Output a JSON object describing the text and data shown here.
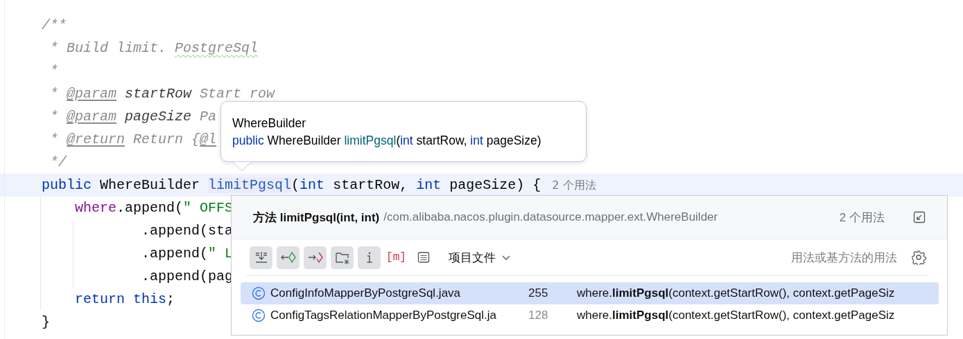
{
  "editor": {
    "lines": [
      {
        "current": false,
        "tokens": [
          {
            "kind": "comment",
            "text": "/**"
          }
        ]
      },
      {
        "current": false,
        "tokens": [
          {
            "kind": "comment",
            "text": " * Build limit. "
          },
          {
            "kind": "typo",
            "text": "PostgreSql"
          }
        ]
      },
      {
        "current": false,
        "tokens": [
          {
            "kind": "comment",
            "text": " *"
          }
        ]
      },
      {
        "current": false,
        "tokens": [
          {
            "kind": "comment",
            "text": " * "
          },
          {
            "kind": "tag",
            "text": "@param"
          },
          {
            "kind": "param",
            "text": " startRow"
          },
          {
            "kind": "comment",
            "text": " Start row"
          }
        ]
      },
      {
        "current": false,
        "tokens": [
          {
            "kind": "comment",
            "text": " * "
          },
          {
            "kind": "tag",
            "text": "@param"
          },
          {
            "kind": "param",
            "text": " pageSize"
          },
          {
            "kind": "comment",
            "text": " Pa"
          }
        ]
      },
      {
        "current": false,
        "tokens": [
          {
            "kind": "comment",
            "text": " * "
          },
          {
            "kind": "tag",
            "text": "@return"
          },
          {
            "kind": "comment",
            "text": " Return {"
          },
          {
            "kind": "tag",
            "text": "@l"
          }
        ]
      },
      {
        "current": false,
        "tokens": [
          {
            "kind": "comment",
            "text": " */"
          }
        ]
      },
      {
        "current": true,
        "tokens": [
          {
            "kind": "keyword",
            "text": "public"
          },
          {
            "kind": "plain",
            "text": " WhereBuilder "
          },
          {
            "kind": "usage",
            "text": "limitPgsql"
          },
          {
            "kind": "plain",
            "text": "("
          },
          {
            "kind": "keyword",
            "text": "int"
          },
          {
            "kind": "plain",
            "text": " startRow, "
          },
          {
            "kind": "keyword",
            "text": "int"
          },
          {
            "kind": "plain",
            "text": " pageSize) {"
          },
          {
            "kind": "hint",
            "text": "2 个用法"
          }
        ]
      },
      {
        "current": false,
        "tokens": [
          {
            "kind": "field",
            "text": "    where"
          },
          {
            "kind": "plain",
            "text": ".append("
          },
          {
            "kind": "string",
            "text": "\" OFFS"
          }
        ]
      },
      {
        "current": false,
        "tokens": [
          {
            "kind": "plain",
            "text": "            .append(sta"
          }
        ]
      },
      {
        "current": false,
        "tokens": [
          {
            "kind": "plain",
            "text": "            .append("
          },
          {
            "kind": "string",
            "text": "\" L"
          }
        ]
      },
      {
        "current": false,
        "tokens": [
          {
            "kind": "plain",
            "text": "            .append(pag"
          }
        ]
      },
      {
        "current": false,
        "tokens": [
          {
            "kind": "keyword",
            "text": "    return this"
          },
          {
            "kind": "plain",
            "text": ";"
          }
        ]
      },
      {
        "current": false,
        "tokens": [
          {
            "kind": "plain",
            "text": "}"
          }
        ]
      }
    ]
  },
  "tooltip": {
    "title": "WhereBuilder",
    "signature": [
      {
        "kind": "keyword",
        "text": "public"
      },
      {
        "kind": "plain",
        "text": " WhereBuilder "
      },
      {
        "kind": "method",
        "text": "limitPgsql"
      },
      {
        "kind": "plain",
        "text": "("
      },
      {
        "kind": "keyword",
        "text": "int"
      },
      {
        "kind": "plain",
        "text": " startRow, "
      },
      {
        "kind": "keyword",
        "text": "int"
      },
      {
        "kind": "plain",
        "text": " pageSize)"
      }
    ]
  },
  "usages_popup": {
    "title": "方法 limitPgsql(int, int)",
    "path": "/com.alibaba.nacos.plugin.datasource.mapper.ext.WhereBuilder",
    "count": "2 个用法",
    "toolbar": [
      {
        "kind": "merge",
        "selected": true
      },
      {
        "kind": "read",
        "selected": true
      },
      {
        "kind": "write",
        "selected": true
      },
      {
        "kind": "folder",
        "selected": true
      },
      {
        "kind": "info",
        "selected": true
      },
      {
        "kind": "module",
        "glyph": "[m]",
        "selected": false
      },
      {
        "kind": "list",
        "selected": false
      }
    ],
    "scope": "项目文件",
    "filter": "用法或基方法的用法",
    "rows": [
      {
        "file": "ConfigInfoMapperByPostgreSql.java",
        "line": "255",
        "code": "where.**limitPgsql**(context.getStartRow(), context.getPageSiz",
        "selected": true
      },
      {
        "file": "ConfigTagsRelationMapperByPostgreSql.ja",
        "line": "128",
        "code": "where.**limitPgsql**(context.getStartRow(), context.getPageSiz",
        "selected": false
      }
    ]
  }
}
